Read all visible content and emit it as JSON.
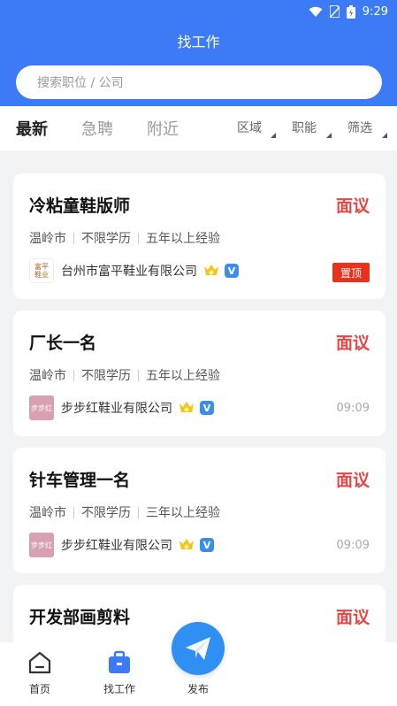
{
  "status_bar": {
    "time": "9:29"
  },
  "header": {
    "title": "找工作"
  },
  "search": {
    "placeholder": "搜索职位 / 公司"
  },
  "tabs": [
    "最新",
    "急聘",
    "附近"
  ],
  "filters": [
    "区域",
    "职能",
    "筛选"
  ],
  "jobs": [
    {
      "title": "冷粘童鞋版师",
      "salary": "面议",
      "tags": [
        "温岭市",
        "不限学历",
        "五年以上经验"
      ],
      "company": "台州市富平鞋业有限公司",
      "logo_text": "富平\n鞋业",
      "badge": "置顶",
      "time": ""
    },
    {
      "title": "厂长一名",
      "salary": "面议",
      "tags": [
        "温岭市",
        "不限学历",
        "五年以上经验"
      ],
      "company": "步步红鞋业有限公司",
      "logo_text": "步步红",
      "badge": "",
      "time": "09:09"
    },
    {
      "title": "针车管理一名",
      "salary": "面议",
      "tags": [
        "温岭市",
        "不限学历",
        "三年以上经验"
      ],
      "company": "步步红鞋业有限公司",
      "logo_text": "步步红",
      "badge": "",
      "time": "09:09"
    },
    {
      "title": "开发部画剪料",
      "salary": "面议",
      "tags": [],
      "company": "",
      "logo_text": "",
      "badge": "",
      "time": ""
    }
  ],
  "bottom_nav": {
    "home": "首页",
    "jobs": "找工作",
    "publish": "发布"
  },
  "colors": {
    "primary": "#3d7af5",
    "salary": "#e84545",
    "badge": "#e8321e",
    "fab": "#2f8ff2"
  },
  "icons": [
    "wifi-icon",
    "sim-icon",
    "battery-icon",
    "home-icon",
    "briefcase-icon",
    "paper-plane-icon",
    "crown-icon",
    "verified-icon"
  ]
}
